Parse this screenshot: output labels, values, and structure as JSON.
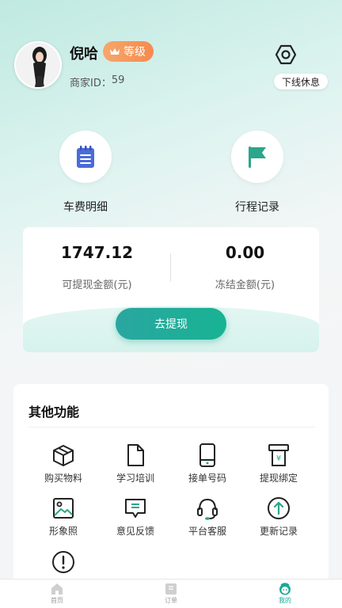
{
  "profile": {
    "name": "倪哈",
    "level_badge": "等级",
    "merchant_id_label": "商家ID：",
    "merchant_id": "59",
    "offline_button": "下线休息"
  },
  "quick_actions": [
    {
      "label": "车费明细",
      "icon": "clipboard-icon"
    },
    {
      "label": "行程记录",
      "icon": "flag-icon"
    }
  ],
  "wallet": {
    "withdrawable_amount": "1747.12",
    "withdrawable_label": "可提现金额(元)",
    "frozen_amount": "0.00",
    "frozen_label": "冻结金额(元)",
    "withdraw_button": "去提现"
  },
  "functions": {
    "title": "其他功能",
    "items": [
      {
        "label": "购买物料",
        "icon": "box-icon"
      },
      {
        "label": "学习培训",
        "icon": "document-icon"
      },
      {
        "label": "接单号码",
        "icon": "phone-icon"
      },
      {
        "label": "提现绑定",
        "icon": "atm-icon"
      },
      {
        "label": "形象照",
        "icon": "image-icon"
      },
      {
        "label": "意见反馈",
        "icon": "feedback-icon"
      },
      {
        "label": "平台客服",
        "icon": "headset-icon"
      },
      {
        "label": "更新记录",
        "icon": "upload-icon"
      },
      {
        "label": "",
        "icon": "alert-icon"
      }
    ]
  },
  "tabbar": [
    {
      "label": "首页",
      "icon": "home-icon",
      "active": false
    },
    {
      "label": "订单",
      "icon": "order-icon",
      "active": false
    },
    {
      "label": "我的",
      "icon": "profile-icon",
      "active": true
    }
  ],
  "colors": {
    "accent": "#1aa998",
    "badge": "#f58a4e",
    "icon_blue": "#4a6cd8",
    "icon_green": "#2ba68a"
  }
}
